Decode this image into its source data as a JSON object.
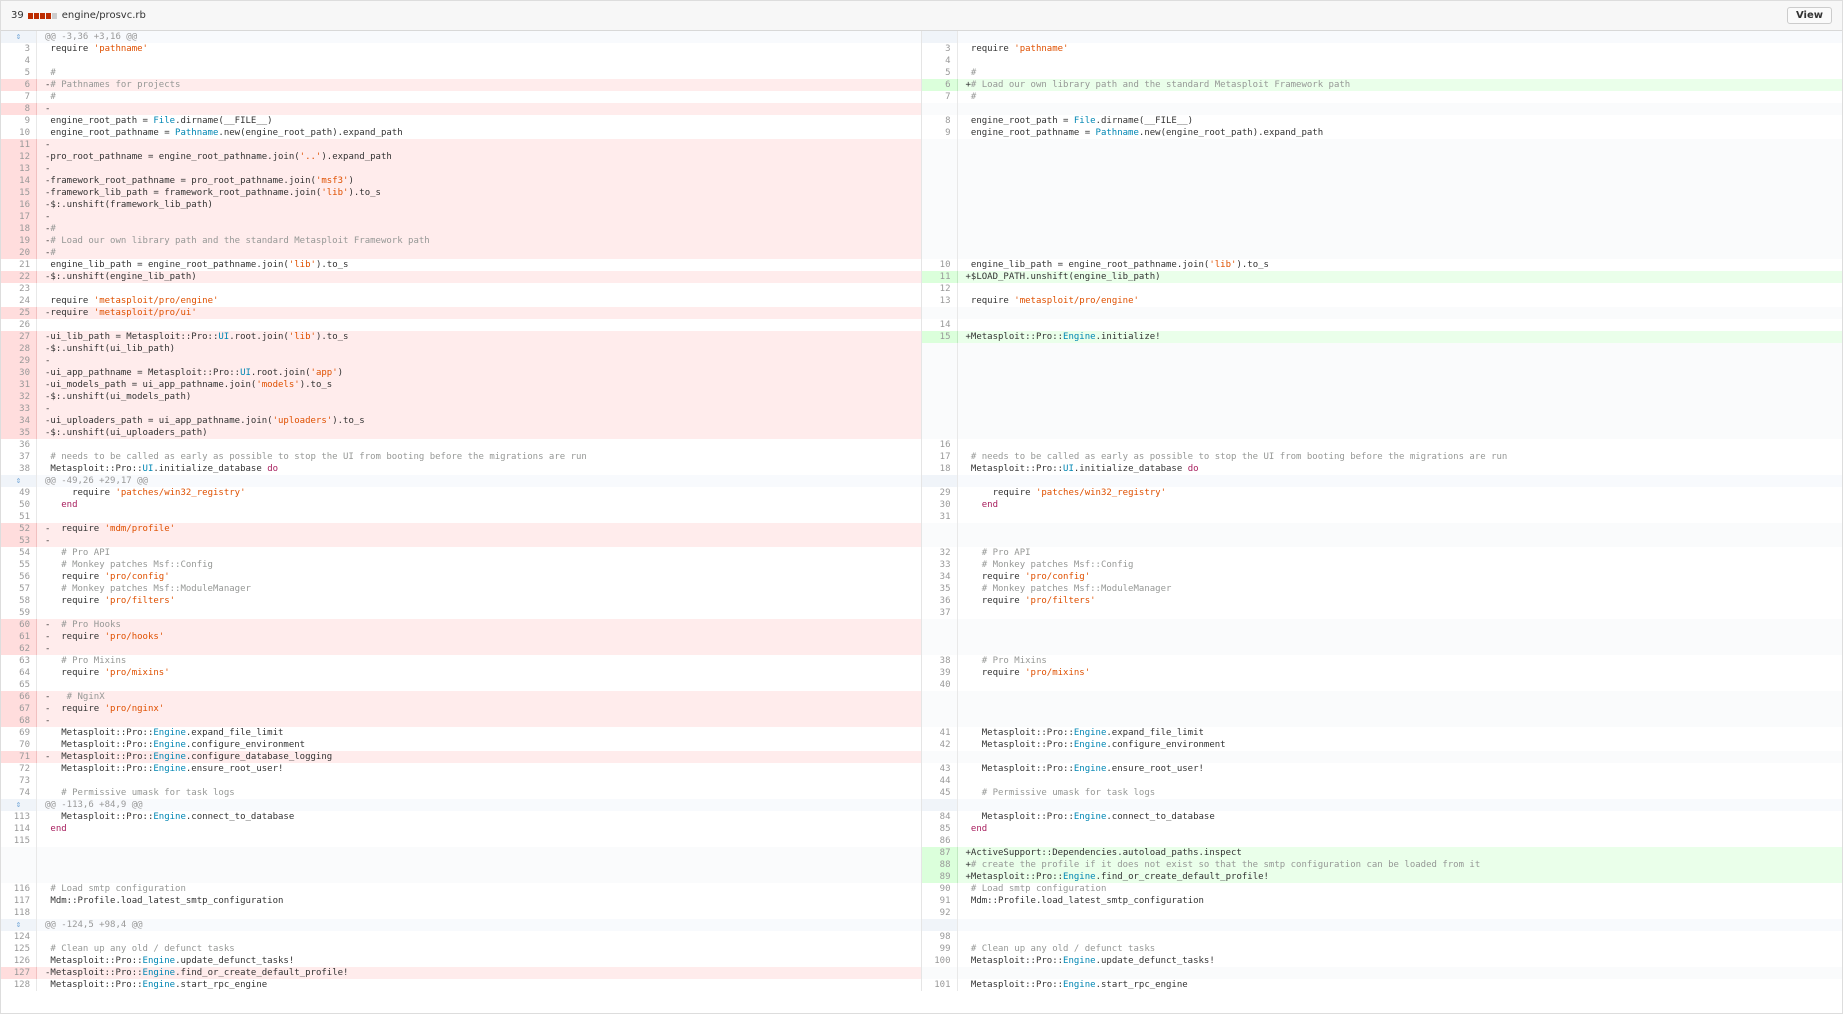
{
  "file": {
    "changes_count": "39",
    "stat_colors": [
      "#bd2c00",
      "#bd2c00",
      "#bd2c00",
      "#bd2c00",
      "#cccccc"
    ],
    "path": "engine/prosvc.rb",
    "view_button": "View"
  },
  "colors": {
    "deleted_bg": "#ffecec",
    "added_bg": "#eaffea",
    "string": "#df5000",
    "constant": "#0086b3",
    "comment": "#969896"
  },
  "icons": {
    "expand": "expand-icon"
  },
  "rows": [
    {
      "k": "h",
      "t": "@@ -3,36 +3,16 @@"
    },
    {
      "l": [
        "3",
        "ctx",
        " require 'pathname'"
      ],
      "r": [
        "3",
        "ctx",
        " require 'pathname'"
      ]
    },
    {
      "l": [
        "4",
        "ctx",
        ""
      ],
      "r": [
        "4",
        "ctx",
        ""
      ]
    },
    {
      "l": [
        "5",
        "ctx",
        " #"
      ],
      "r": [
        "5",
        "ctx",
        " #"
      ]
    },
    {
      "l": [
        "6",
        "del",
        "-# Pathnames for projects"
      ],
      "r": [
        "6",
        "add",
        "+# Load our own library path and the standard Metasploit Framework path"
      ]
    },
    {
      "l": [
        "7",
        "ctx",
        " #"
      ],
      "r": [
        "7",
        "ctx",
        " #"
      ]
    },
    {
      "l": [
        "8",
        "del",
        "-"
      ],
      "r": null
    },
    {
      "l": [
        "9",
        "ctx",
        " engine_root_path = File.dirname(__FILE__)"
      ],
      "r": [
        "8",
        "ctx",
        " engine_root_path = File.dirname(__FILE__)"
      ]
    },
    {
      "l": [
        "10",
        "ctx",
        " engine_root_pathname = Pathname.new(engine_root_path).expand_path"
      ],
      "r": [
        "9",
        "ctx",
        " engine_root_pathname = Pathname.new(engine_root_path).expand_path"
      ]
    },
    {
      "l": [
        "11",
        "del",
        "-"
      ],
      "r": null
    },
    {
      "l": [
        "12",
        "del",
        "-pro_root_pathname = engine_root_pathname.join('..').expand_path"
      ],
      "r": null
    },
    {
      "l": [
        "13",
        "del",
        "-"
      ],
      "r": null
    },
    {
      "l": [
        "14",
        "del",
        "-framework_root_pathname = pro_root_pathname.join('msf3')"
      ],
      "r": null
    },
    {
      "l": [
        "15",
        "del",
        "-framework_lib_path = framework_root_pathname.join('lib').to_s"
      ],
      "r": null
    },
    {
      "l": [
        "16",
        "del",
        "-$:.unshift(framework_lib_path)"
      ],
      "r": null
    },
    {
      "l": [
        "17",
        "del",
        "-"
      ],
      "r": null
    },
    {
      "l": [
        "18",
        "del",
        "-#"
      ],
      "r": null
    },
    {
      "l": [
        "19",
        "del",
        "-# Load our own library path and the standard Metasploit Framework path"
      ],
      "r": null
    },
    {
      "l": [
        "20",
        "del",
        "-#"
      ],
      "r": null
    },
    {
      "l": [
        "21",
        "ctx",
        " engine_lib_path = engine_root_pathname.join('lib').to_s"
      ],
      "r": [
        "10",
        "ctx",
        " engine_lib_path = engine_root_pathname.join('lib').to_s"
      ]
    },
    {
      "l": [
        "22",
        "del",
        "-$:.unshift(engine_lib_path)"
      ],
      "r": [
        "11",
        "add",
        "+$LOAD_PATH.unshift(engine_lib_path)"
      ]
    },
    {
      "l": [
        "23",
        "ctx",
        ""
      ],
      "r": [
        "12",
        "ctx",
        ""
      ]
    },
    {
      "l": [
        "24",
        "ctx",
        " require 'metasploit/pro/engine'"
      ],
      "r": [
        "13",
        "ctx",
        " require 'metasploit/pro/engine'"
      ]
    },
    {
      "l": [
        "25",
        "del",
        "-require 'metasploit/pro/ui'"
      ],
      "r": null
    },
    {
      "l": [
        "26",
        "ctx",
        ""
      ],
      "r": [
        "14",
        "ctx",
        ""
      ]
    },
    {
      "l": [
        "27",
        "del",
        "-ui_lib_path = Metasploit::Pro::UI.root.join('lib').to_s"
      ],
      "r": [
        "15",
        "add",
        "+Metasploit::Pro::Engine.initialize!"
      ]
    },
    {
      "l": [
        "28",
        "del",
        "-$:.unshift(ui_lib_path)"
      ],
      "r": null
    },
    {
      "l": [
        "29",
        "del",
        "-"
      ],
      "r": null
    },
    {
      "l": [
        "30",
        "del",
        "-ui_app_pathname = Metasploit::Pro::UI.root.join('app')"
      ],
      "r": null
    },
    {
      "l": [
        "31",
        "del",
        "-ui_models_path = ui_app_pathname.join('models').to_s"
      ],
      "r": null
    },
    {
      "l": [
        "32",
        "del",
        "-$:.unshift(ui_models_path)"
      ],
      "r": null
    },
    {
      "l": [
        "33",
        "del",
        "-"
      ],
      "r": null
    },
    {
      "l": [
        "34",
        "del",
        "-ui_uploaders_path = ui_app_pathname.join('uploaders').to_s"
      ],
      "r": null
    },
    {
      "l": [
        "35",
        "del",
        "-$:.unshift(ui_uploaders_path)"
      ],
      "r": null
    },
    {
      "l": [
        "36",
        "ctx",
        ""
      ],
      "r": [
        "16",
        "ctx",
        ""
      ]
    },
    {
      "l": [
        "37",
        "ctx",
        " # needs to be called as early as possible to stop the UI from booting before the migrations are run"
      ],
      "r": [
        "17",
        "ctx",
        " # needs to be called as early as possible to stop the UI from booting before the migrations are run"
      ]
    },
    {
      "l": [
        "38",
        "ctx",
        " Metasploit::Pro::UI.initialize_database do"
      ],
      "r": [
        "18",
        "ctx",
        " Metasploit::Pro::UI.initialize_database do"
      ]
    },
    {
      "k": "h",
      "t": "@@ -49,26 +29,17 @@"
    },
    {
      "l": [
        "49",
        "ctx",
        "     require 'patches/win32_registry'"
      ],
      "r": [
        "29",
        "ctx",
        "     require 'patches/win32_registry'"
      ]
    },
    {
      "l": [
        "50",
        "ctx",
        "   end"
      ],
      "r": [
        "30",
        "ctx",
        "   end"
      ]
    },
    {
      "l": [
        "51",
        "ctx",
        ""
      ],
      "r": [
        "31",
        "ctx",
        ""
      ]
    },
    {
      "l": [
        "52",
        "del",
        "-  require 'mdm/profile'"
      ],
      "r": null
    },
    {
      "l": [
        "53",
        "del",
        "-"
      ],
      "r": null
    },
    {
      "l": [
        "54",
        "ctx",
        "   # Pro API"
      ],
      "r": [
        "32",
        "ctx",
        "   # Pro API"
      ]
    },
    {
      "l": [
        "55",
        "ctx",
        "   # Monkey patches Msf::Config"
      ],
      "r": [
        "33",
        "ctx",
        "   # Monkey patches Msf::Config"
      ]
    },
    {
      "l": [
        "56",
        "ctx",
        "   require 'pro/config'"
      ],
      "r": [
        "34",
        "ctx",
        "   require 'pro/config'"
      ]
    },
    {
      "l": [
        "57",
        "ctx",
        "   # Monkey patches Msf::ModuleManager"
      ],
      "r": [
        "35",
        "ctx",
        "   # Monkey patches Msf::ModuleManager"
      ]
    },
    {
      "l": [
        "58",
        "ctx",
        "   require 'pro/filters'"
      ],
      "r": [
        "36",
        "ctx",
        "   require 'pro/filters'"
      ]
    },
    {
      "l": [
        "59",
        "ctx",
        ""
      ],
      "r": [
        "37",
        "ctx",
        ""
      ]
    },
    {
      "l": [
        "60",
        "del",
        "-  # Pro Hooks"
      ],
      "r": null
    },
    {
      "l": [
        "61",
        "del",
        "-  require 'pro/hooks'"
      ],
      "r": null
    },
    {
      "l": [
        "62",
        "del",
        "-"
      ],
      "r": null
    },
    {
      "l": [
        "63",
        "ctx",
        "   # Pro Mixins"
      ],
      "r": [
        "38",
        "ctx",
        "   # Pro Mixins"
      ]
    },
    {
      "l": [
        "64",
        "ctx",
        "   require 'pro/mixins'"
      ],
      "r": [
        "39",
        "ctx",
        "   require 'pro/mixins'"
      ]
    },
    {
      "l": [
        "65",
        "ctx",
        ""
      ],
      "r": [
        "40",
        "ctx",
        ""
      ]
    },
    {
      "l": [
        "66",
        "del",
        "-   # NginX"
      ],
      "r": null
    },
    {
      "l": [
        "67",
        "del",
        "-  require 'pro/nginx'"
      ],
      "r": null
    },
    {
      "l": [
        "68",
        "del",
        "-"
      ],
      "r": null
    },
    {
      "l": [
        "69",
        "ctx",
        "   Metasploit::Pro::Engine.expand_file_limit"
      ],
      "r": [
        "41",
        "ctx",
        "   Metasploit::Pro::Engine.expand_file_limit"
      ]
    },
    {
      "l": [
        "70",
        "ctx",
        "   Metasploit::Pro::Engine.configure_environment"
      ],
      "r": [
        "42",
        "ctx",
        "   Metasploit::Pro::Engine.configure_environment"
      ]
    },
    {
      "l": [
        "71",
        "del",
        "-  Metasploit::Pro::Engine.configure_database_logging"
      ],
      "r": null
    },
    {
      "l": [
        "72",
        "ctx",
        "   Metasploit::Pro::Engine.ensure_root_user!"
      ],
      "r": [
        "43",
        "ctx",
        "   Metasploit::Pro::Engine.ensure_root_user!"
      ]
    },
    {
      "l": [
        "73",
        "ctx",
        ""
      ],
      "r": [
        "44",
        "ctx",
        ""
      ]
    },
    {
      "l": [
        "74",
        "ctx",
        "   # Permissive umask for task logs"
      ],
      "r": [
        "45",
        "ctx",
        "   # Permissive umask for task logs"
      ]
    },
    {
      "k": "h",
      "t": "@@ -113,6 +84,9 @@"
    },
    {
      "l": [
        "113",
        "ctx",
        "   Metasploit::Pro::Engine.connect_to_database"
      ],
      "r": [
        "84",
        "ctx",
        "   Metasploit::Pro::Engine.connect_to_database"
      ]
    },
    {
      "l": [
        "114",
        "ctx",
        " end"
      ],
      "r": [
        "85",
        "ctx",
        " end"
      ]
    },
    {
      "l": [
        "115",
        "ctx",
        ""
      ],
      "r": [
        "86",
        "ctx",
        ""
      ]
    },
    {
      "l": null,
      "r": [
        "87",
        "add",
        "+ActiveSupport::Dependencies.autoload_paths.inspect"
      ]
    },
    {
      "l": null,
      "r": [
        "88",
        "add",
        "+# create the profile if it does not exist so that the smtp configuration can be loaded from it"
      ]
    },
    {
      "l": null,
      "r": [
        "89",
        "add",
        "+Metasploit::Pro::Engine.find_or_create_default_profile!"
      ]
    },
    {
      "l": [
        "116",
        "ctx",
        " # Load smtp configuration"
      ],
      "r": [
        "90",
        "ctx",
        " # Load smtp configuration"
      ]
    },
    {
      "l": [
        "117",
        "ctx",
        " Mdm::Profile.load_latest_smtp_configuration"
      ],
      "r": [
        "91",
        "ctx",
        " Mdm::Profile.load_latest_smtp_configuration"
      ]
    },
    {
      "l": [
        "118",
        "ctx",
        ""
      ],
      "r": [
        "92",
        "ctx",
        ""
      ]
    },
    {
      "k": "h",
      "t": "@@ -124,5 +98,4 @@"
    },
    {
      "l": [
        "124",
        "ctx",
        ""
      ],
      "r": [
        "98",
        "ctx",
        ""
      ]
    },
    {
      "l": [
        "125",
        "ctx",
        " # Clean up any old / defunct tasks"
      ],
      "r": [
        "99",
        "ctx",
        " # Clean up any old / defunct tasks"
      ]
    },
    {
      "l": [
        "126",
        "ctx",
        " Metasploit::Pro::Engine.update_defunct_tasks!"
      ],
      "r": [
        "100",
        "ctx",
        " Metasploit::Pro::Engine.update_defunct_tasks!"
      ]
    },
    {
      "l": [
        "127",
        "del",
        "-Metasploit::Pro::Engine.find_or_create_default_profile!"
      ],
      "r": null
    },
    {
      "l": [
        "128",
        "ctx",
        " Metasploit::Pro::Engine.start_rpc_engine"
      ],
      "r": [
        "101",
        "ctx",
        " Metasploit::Pro::Engine.start_rpc_engine"
      ]
    }
  ]
}
